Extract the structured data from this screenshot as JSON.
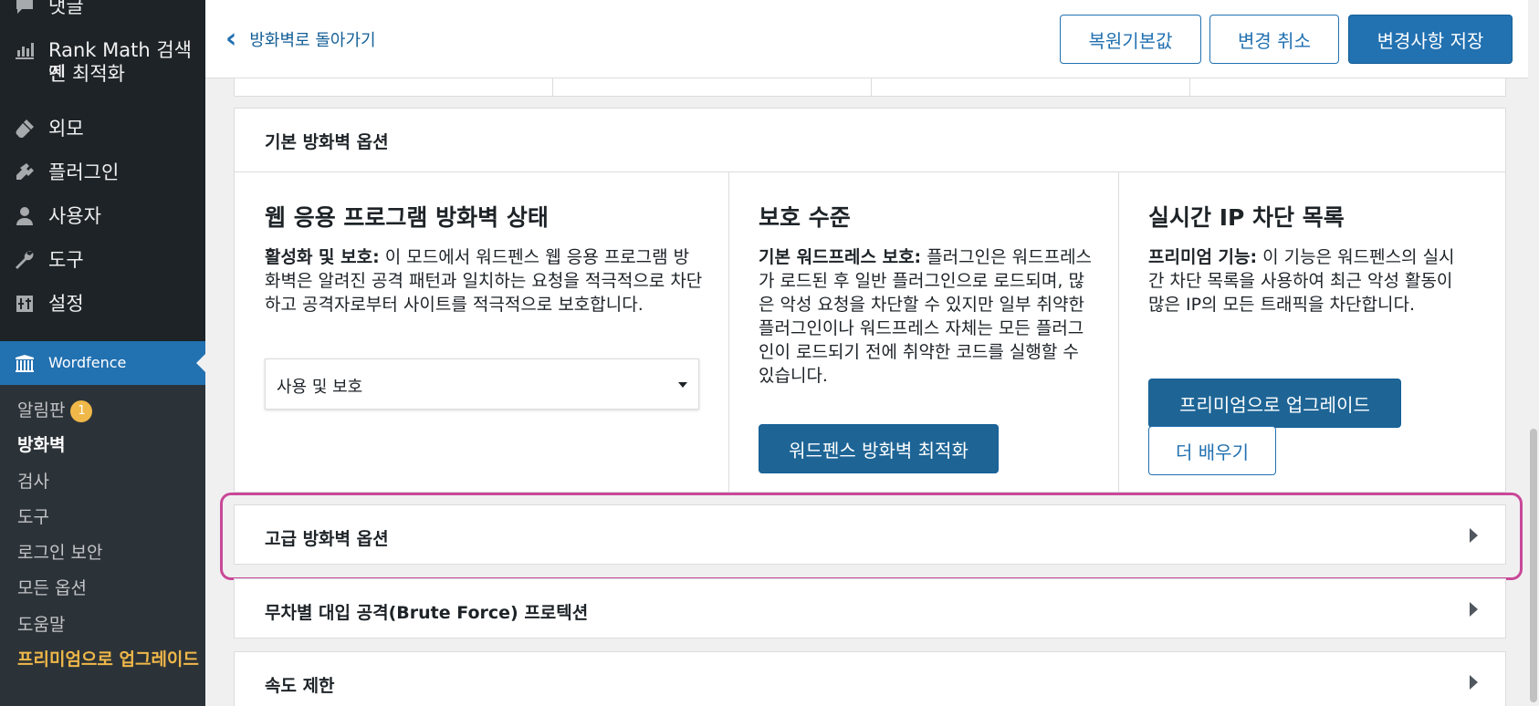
{
  "sidebar": {
    "items": [
      {
        "label": "댓글",
        "icon": "comments-icon"
      },
      {
        "label": "Rank Math 검색엔진 최적화",
        "icon": "rank-math-icon"
      },
      {
        "label": "외모",
        "icon": "appearance-icon"
      },
      {
        "label": "플러그인",
        "icon": "plugins-icon"
      },
      {
        "label": "사용자",
        "icon": "users-icon"
      },
      {
        "label": "도구",
        "icon": "tools-icon"
      },
      {
        "label": "설정",
        "icon": "settings-icon"
      }
    ],
    "active": {
      "label": "Wordfence",
      "icon": "wordfence-icon"
    },
    "rank_math_line1": "Rank Math 검색엔",
    "rank_math_line2": "진 최적화",
    "submenu": [
      {
        "label": "알림판",
        "badge": "1"
      },
      {
        "label": "방화벽",
        "current": true
      },
      {
        "label": "검사"
      },
      {
        "label": "도구"
      },
      {
        "label": "로그인 보안"
      },
      {
        "label": "모든 옵션"
      },
      {
        "label": "도움말"
      },
      {
        "label": "프리미엄으로 업그레이드"
      }
    ]
  },
  "header": {
    "back_label": "방화벽로 돌아가기",
    "restore_label": "복원기본값",
    "cancel_label": "변경 취소",
    "save_label": "변경사항 저장"
  },
  "basic_options": {
    "title": "기본 방화벽 옵션",
    "columns": [
      {
        "heading": "웹 응용 프로그램 방화벽 상태",
        "bold": "활성화 및 보호:",
        "text": " 이 모드에서 워드펜스 웹 응용 프로그램 방화벽은 알려진 공격 패턴과 일치하는 요청을 적극적으로 차단하고 공격자로부터 사이트를 적극적으로 보호합니다.",
        "select_value": "사용 및 보호"
      },
      {
        "heading": "보호 수준",
        "bold": "기본 워드프레스 보호:",
        "text": " 플러그인은 워드프레스가 로드된 후 일반 플러그인으로 로드되며, 많은 악성 요청을 차단할 수 있지만 일부 취약한 플러그인이나 워드프레스 자체는 모든 플러그인이 로드되기 전에 취약한 코드를 실행할 수 있습니다.",
        "button": "워드펜스 방화벽 최적화"
      },
      {
        "heading": "실시간 IP 차단 목록",
        "bold": "프리미엄 기능:",
        "text": " 이 기능은 워드펜스의 실시간 차단 목록을 사용하여 최근 악성 활동이 많은 IP의 모든 트래픽을 차단합니다.",
        "button_primary": "프리미엄으로 업그레이드",
        "button_secondary": "더 배우기"
      }
    ]
  },
  "sections": [
    {
      "title": "고급 방화벽 옵션",
      "highlighted": true
    },
    {
      "title": "무차별 대입 공격(Brute Force) 프로텍션"
    },
    {
      "title": "속도 제한"
    }
  ],
  "colors": {
    "sidebar_bg": "#1d2327",
    "accent": "#2271b1",
    "premium": "#f0b849",
    "highlight": "#c94898"
  }
}
